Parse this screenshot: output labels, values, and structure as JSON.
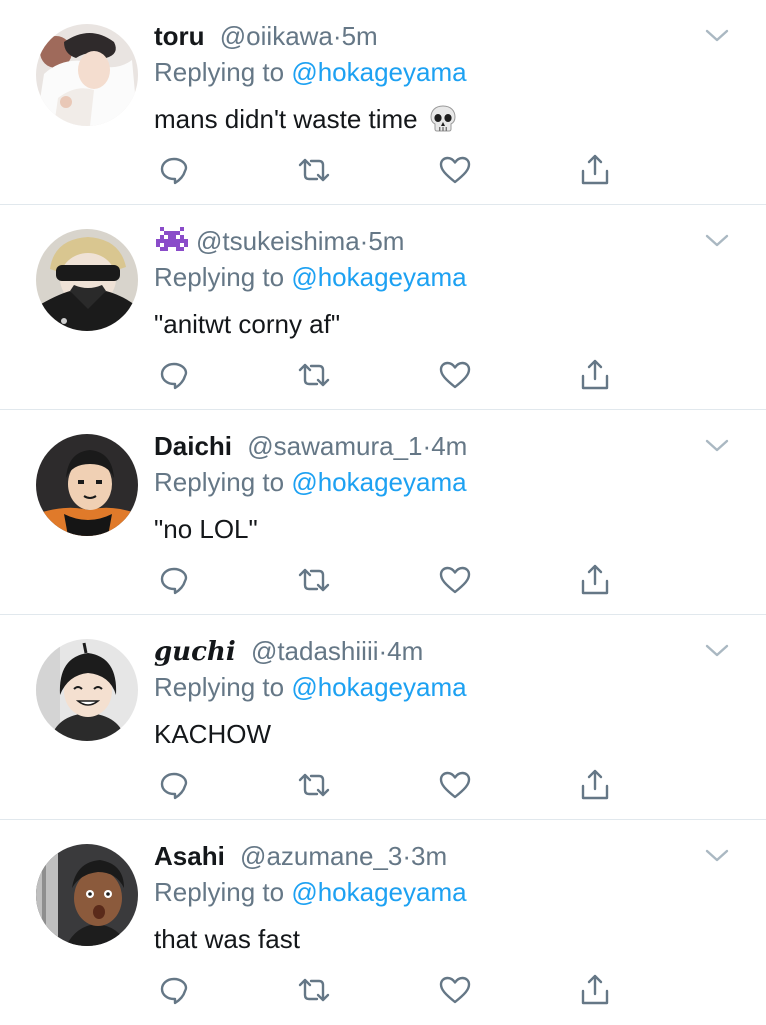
{
  "reply_prefix": "Replying to",
  "tweets": [
    {
      "name": "toru",
      "handle": "@oiikawa",
      "time": "5m",
      "reply_to": "@hokageyama",
      "text": "mans didn't waste time",
      "trailing_emoji": "skull-emoji"
    },
    {
      "name": "",
      "name_emoji": "alien-monster-emoji",
      "handle": "@tsukeishima",
      "time": "5m",
      "reply_to": "@hokageyama",
      "text": "\"anitwt corny af\""
    },
    {
      "name": "Daichi",
      "handle": "@sawamura_1",
      "time": "4m",
      "reply_to": "@hokageyama",
      "text": "\"no LOL\""
    },
    {
      "name": "guchi",
      "handle": "@tadashiiii",
      "time": "4m",
      "reply_to": "@hokageyama",
      "text": "KACHOW"
    },
    {
      "name": "Asahi",
      "handle": "@azumane_3",
      "time": "3m",
      "reply_to": "@hokageyama",
      "text": "that was fast"
    }
  ],
  "icons": {
    "reply": "reply-icon",
    "retweet": "retweet-icon",
    "like": "heart-icon",
    "share": "share-icon",
    "menu": "chevron-down-icon"
  },
  "colors": {
    "mention": "#1da1f2",
    "secondary_text": "#657786",
    "icon": "#657786",
    "divider": "#e1e8ed"
  }
}
